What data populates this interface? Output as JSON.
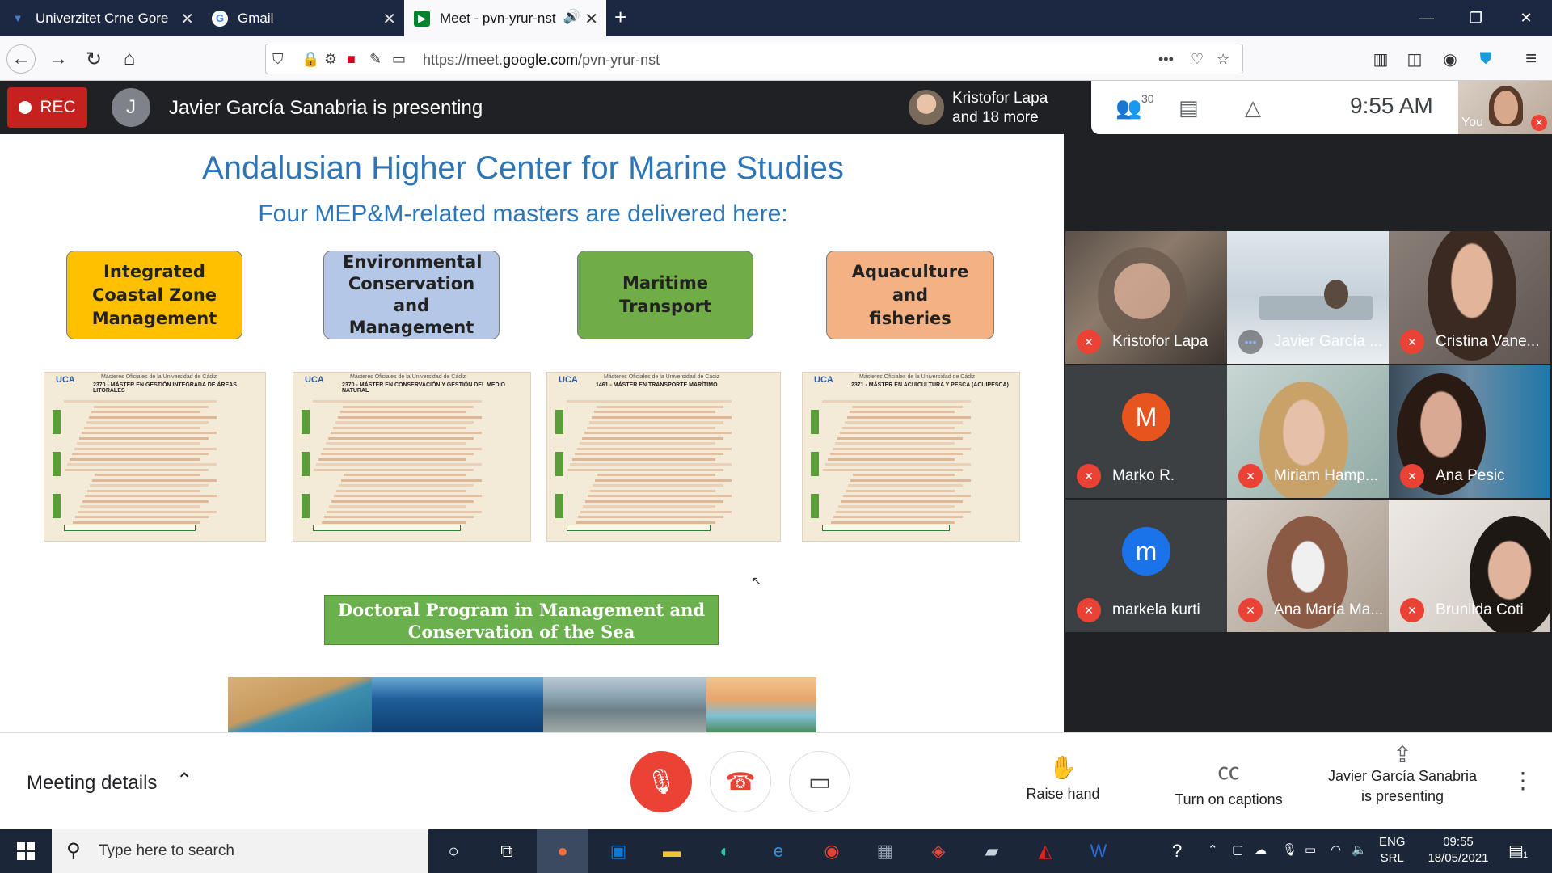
{
  "browser": {
    "tabs": [
      {
        "label": "Univerzitet Crne Gore"
      },
      {
        "label": "Gmail"
      },
      {
        "label": "Meet - pvn-yrur-nst"
      }
    ],
    "url_prefix": "https://meet.",
    "url_domain": "google.com",
    "url_path": "/pvn-yrur-nst"
  },
  "meet": {
    "rec_label": "REC",
    "presenter_initial": "J",
    "presenter_text": "Javier García Sanabria is presenting",
    "participants_name": "Kristofor Lapa",
    "participants_more": "and 18 more",
    "participant_count": "30",
    "time": "9:55  AM",
    "you_label": "You"
  },
  "slide": {
    "title": "Andalusian Higher Center for Marine Studies",
    "subtitle": "Four MEP&M-related masters are delivered here:",
    "masters": [
      {
        "label": "Integrated Coastal Zone Management",
        "color": "#ffc000"
      },
      {
        "label": "Environmental Conservation and Management",
        "color": "#b4c7e7"
      },
      {
        "label": "Maritime Transport",
        "color": "#70ad47"
      },
      {
        "label": "Aquaculture and fisheries",
        "color": "#f4b183"
      }
    ],
    "posters": [
      {
        "header": "Másteres Oficiales de la Universidad de Cádiz",
        "code": "2370 - MÁSTER EN GESTIÓN INTEGRADA DE ÁREAS LITORALES"
      },
      {
        "header": "Másteres Oficiales de la Universidad de Cádiz",
        "code": "2370 - MÁSTER EN CONSERVACIÓN Y GESTIÓN DEL MEDIO NATURAL"
      },
      {
        "header": "Másteres Oficiales de la Universidad de Cádiz",
        "code": "1461 - MÁSTER EN TRANSPORTE MARÍTIMO"
      },
      {
        "header": "Másteres Oficiales de la Universidad de Cádiz",
        "code": "2371 - MÁSTER EN ACUICULTURA Y PESCA (ACUIPESCA)"
      }
    ],
    "poster_logo": "UCA",
    "doctoral": "Doctoral Program in Management and Conservation of the Sea"
  },
  "participants": [
    {
      "name": "Kristofor Lapa",
      "muted": true
    },
    {
      "name": "Javier García ...",
      "muted": false
    },
    {
      "name": "Cristina Vane...",
      "muted": true
    },
    {
      "name": "Marko R.",
      "muted": true,
      "initial": "M",
      "color": "#e8541e"
    },
    {
      "name": "Miriam Hamp...",
      "muted": true
    },
    {
      "name": "Ana Pesic",
      "muted": true
    },
    {
      "name": "markela kurti",
      "muted": true,
      "initial": "m",
      "color": "#1a73e8"
    },
    {
      "name": "Ana María Ma...",
      "muted": true
    },
    {
      "name": "Brunilda Coti",
      "muted": true
    }
  ],
  "bottom": {
    "meeting_details": "Meeting details",
    "raise_hand": "Raise hand",
    "captions": "Turn on captions",
    "presenting_line1": "Javier García Sanabria",
    "presenting_line2": "is presenting"
  },
  "taskbar": {
    "search_placeholder": "Type here to search",
    "lang1": "ENG",
    "lang2": "SRL",
    "time": "09:55",
    "date": "18/05/2021",
    "notif_count": "1"
  }
}
